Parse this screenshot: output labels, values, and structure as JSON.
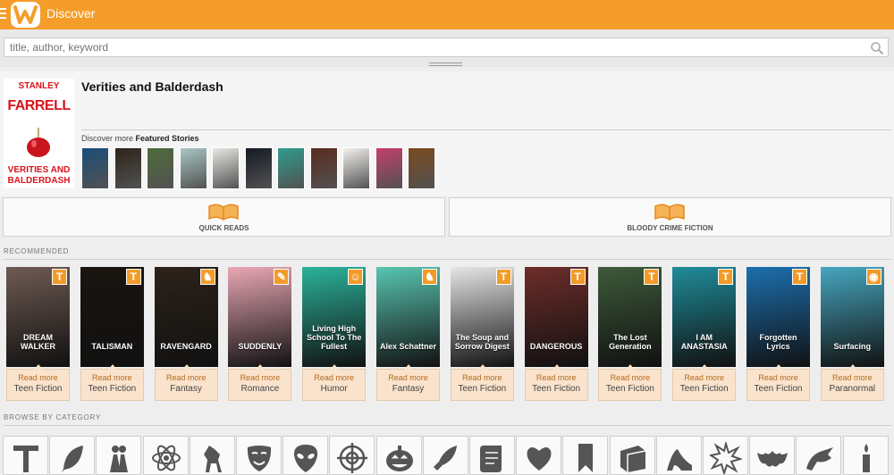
{
  "header": {
    "title": "Discover",
    "menu_icon": "hamburger-icon",
    "logo_icon": "wattpad-logo-icon",
    "accent": "#f59d2a"
  },
  "search": {
    "placeholder": "title, author, keyword",
    "icon": "search-icon"
  },
  "featured": {
    "cover": {
      "author_first": "STANLEY",
      "author_last": "FARRELL",
      "title_line1": "VERITIES AND",
      "title_line2": "BALDERDASH"
    },
    "title": "Verities and Balderdash",
    "discover_prefix": "Discover more ",
    "discover_bold": "Featured Stories",
    "mini_covers": [
      "#1b4d7a",
      "#2d2418",
      "#4e6b3a",
      "#a9c7c4",
      "#e7e7e2",
      "#151a24",
      "#2f9c8e",
      "#5a2b1d",
      "#f4f2ef",
      "#c43f6d",
      "#7a4a1c"
    ]
  },
  "categories": [
    {
      "label": "QUICK READS",
      "icon": "open-book-icon"
    },
    {
      "label": "BLOODY CRIME FICTION",
      "icon": "open-book-icon"
    }
  ],
  "recommended": {
    "heading": "RECOMMENDED",
    "read_more": "Read more",
    "items": [
      {
        "title": "DREAM WALKER",
        "genre": "Teen Fiction",
        "badge": "T",
        "color": "#6e5a52"
      },
      {
        "title": "TALISMAN",
        "genre": "Teen Fiction",
        "badge": "T",
        "color": "#1a1410"
      },
      {
        "title": "RAVENGARD",
        "genre": "Fantasy",
        "badge": "horse",
        "color": "#2c2219"
      },
      {
        "title": "SUDDENLY",
        "genre": "Romance",
        "badge": "quill",
        "color": "#e9a7b4"
      },
      {
        "title": "Living High School To The Fullest",
        "genre": "Humor",
        "badge": "mask",
        "color": "#2bb29a"
      },
      {
        "title": "Alex Schattner",
        "genre": "Fantasy",
        "badge": "horse",
        "color": "#58c4b0"
      },
      {
        "title": "The Soup and Sorrow Digest",
        "genre": "Teen Fiction",
        "badge": "T",
        "color": "#e6e6e6"
      },
      {
        "title": "DANGEROUS",
        "genre": "Teen Fiction",
        "badge": "T",
        "color": "#6d2d2a"
      },
      {
        "title": "The Lost Generation",
        "genre": "Teen Fiction",
        "badge": "T",
        "color": "#3d5a3a"
      },
      {
        "title": "I AM ANASTASIA",
        "genre": "Teen Fiction",
        "badge": "T",
        "color": "#1f8c9a"
      },
      {
        "title": "Forgotten Lyrics",
        "genre": "Teen Fiction",
        "badge": "T",
        "color": "#1c6fae"
      },
      {
        "title": "Surfacing",
        "genre": "Paranormal",
        "badge": "alien",
        "color": "#46a6bf"
      }
    ]
  },
  "browse": {
    "heading": "BROWSE BY CATEGORY",
    "icons": [
      "t-letter-icon",
      "feather-icon",
      "romance-couple-icon",
      "atom-icon",
      "horse-icon",
      "mask-icon",
      "alien-icon",
      "crosshair-icon",
      "pumpkin-icon",
      "rocket-icon",
      "scroll-icon",
      "heart-icon",
      "bookmark-icon",
      "book-icon",
      "high-heel-icon",
      "starburst-icon",
      "bat-icon",
      "dragon-icon",
      "candle-icon"
    ]
  }
}
